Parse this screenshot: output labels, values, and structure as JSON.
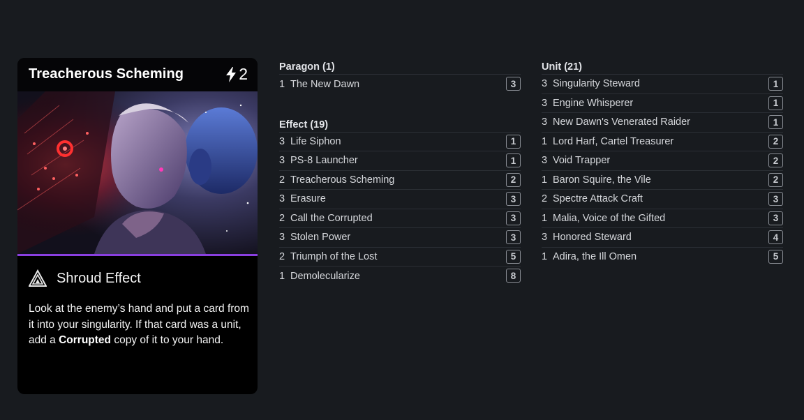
{
  "card": {
    "title": "Treacherous Scheming",
    "cost": "2",
    "cost_icon": "lightning-bolt",
    "type_icon": "shroud-triangle",
    "type": "Shroud Effect",
    "accent_color": "#8a3fe0",
    "text_before": "Look at the enemy’s hand and put a card from it into your singularity. If that card was a unit, add a ",
    "text_bold": "Corrupted",
    "text_after": " copy of it to your hand."
  },
  "sections": {
    "paragon": {
      "title": "Paragon (1)",
      "cards": [
        {
          "qty": "1",
          "name": "The New Dawn",
          "cost": "3"
        }
      ]
    },
    "effect": {
      "title": "Effect (19)",
      "cards": [
        {
          "qty": "3",
          "name": "Life Siphon",
          "cost": "1"
        },
        {
          "qty": "3",
          "name": "PS-8 Launcher",
          "cost": "1"
        },
        {
          "qty": "2",
          "name": "Treacherous Scheming",
          "cost": "2"
        },
        {
          "qty": "3",
          "name": "Erasure",
          "cost": "3"
        },
        {
          "qty": "2",
          "name": "Call the Corrupted",
          "cost": "3"
        },
        {
          "qty": "3",
          "name": "Stolen Power",
          "cost": "3"
        },
        {
          "qty": "2",
          "name": "Triumph of the Lost",
          "cost": "5"
        },
        {
          "qty": "1",
          "name": "Demolecularize",
          "cost": "8"
        }
      ]
    },
    "unit": {
      "title": "Unit (21)",
      "cards": [
        {
          "qty": "3",
          "name": "Singularity Steward",
          "cost": "1"
        },
        {
          "qty": "3",
          "name": "Engine Whisperer",
          "cost": "1"
        },
        {
          "qty": "3",
          "name": "New Dawn's Venerated Raider",
          "cost": "1"
        },
        {
          "qty": "1",
          "name": "Lord Harf, Cartel Treasurer",
          "cost": "2"
        },
        {
          "qty": "3",
          "name": "Void Trapper",
          "cost": "2"
        },
        {
          "qty": "1",
          "name": "Baron Squire, the Vile",
          "cost": "2"
        },
        {
          "qty": "2",
          "name": "Spectre Attack Craft",
          "cost": "3"
        },
        {
          "qty": "1",
          "name": "Malia, Voice of the Gifted",
          "cost": "3"
        },
        {
          "qty": "3",
          "name": "Honored Steward",
          "cost": "4"
        },
        {
          "qty": "1",
          "name": "Adira, the Ill Omen",
          "cost": "5"
        }
      ]
    }
  }
}
